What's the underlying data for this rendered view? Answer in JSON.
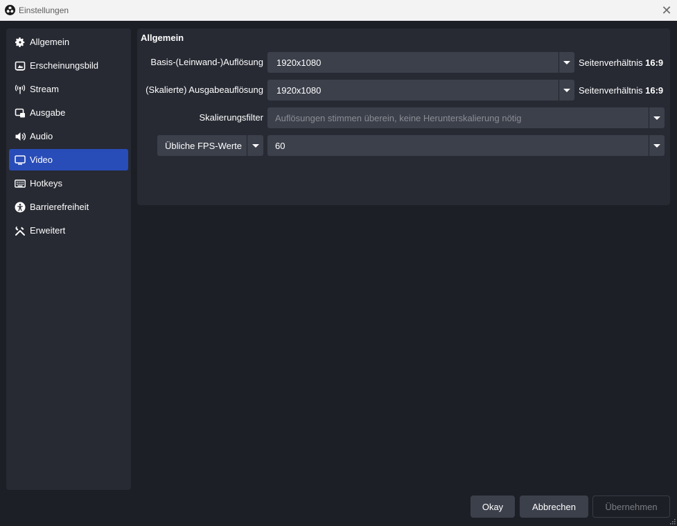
{
  "window": {
    "title": "Einstellungen",
    "close_glyph": "✕"
  },
  "sidebar": {
    "items": [
      {
        "label": "Allgemein",
        "icon": "gear-icon"
      },
      {
        "label": "Erscheinungsbild",
        "icon": "appearance-icon"
      },
      {
        "label": "Stream",
        "icon": "antenna-icon"
      },
      {
        "label": "Ausgabe",
        "icon": "output-icon"
      },
      {
        "label": "Audio",
        "icon": "speaker-icon"
      },
      {
        "label": "Video",
        "icon": "monitor-icon",
        "active": true
      },
      {
        "label": "Hotkeys",
        "icon": "keyboard-icon"
      },
      {
        "label": "Barrierefreiheit",
        "icon": "accessibility-icon"
      },
      {
        "label": "Erweitert",
        "icon": "tools-icon"
      }
    ]
  },
  "video": {
    "section_title": "Allgemein",
    "base_resolution": {
      "label": "Basis-(Leinwand-)Auflösung",
      "value": "1920x1080",
      "aspect_prefix": "Seitenverhältnis",
      "aspect_value": "16:9"
    },
    "output_resolution": {
      "label": "(Skalierte) Ausgabeauflösung",
      "value": "1920x1080",
      "aspect_prefix": "Seitenverhältnis",
      "aspect_value": "16:9"
    },
    "scale_filter": {
      "label": "Skalierungsfilter",
      "value": "Auflösungen stimmen überein, keine Herunterskalierung nötig"
    },
    "fps": {
      "type_label": "Übliche FPS-Werte",
      "value": "60"
    }
  },
  "buttons": {
    "ok": "Okay",
    "cancel": "Abbrechen",
    "apply": "Übernehmen"
  },
  "colors": {
    "accent": "#284cb8",
    "background": "#1d1f26",
    "panel": "#272a33",
    "control": "#3c404b"
  }
}
